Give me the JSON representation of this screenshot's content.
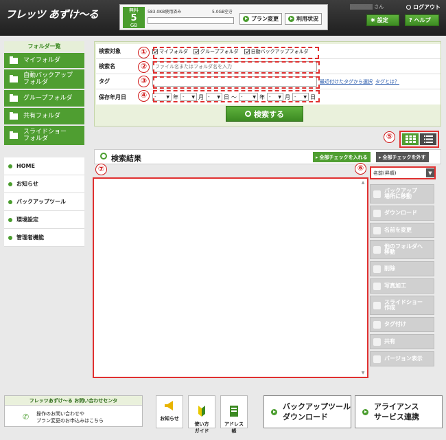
{
  "header": {
    "logo": "フレッツ あずけ〜る",
    "plan_label": "無料",
    "plan_size": "5",
    "plan_unit": "GB",
    "used": "583.0KB使用済み",
    "free": "5.0GB空き",
    "plan_change": "プラン変更",
    "usage_status": "利用状況",
    "user_suffix": "さん",
    "logout": "ログアウト",
    "settings": "設定",
    "help": "ヘルプ"
  },
  "sidebar": {
    "folder_title": "フォルダ一覧",
    "folders": [
      "マイフォルダ",
      "自動バックアップ\nフォルダ",
      "グループフォルダ",
      "共有フォルダ",
      "スライドショー\nフォルダ"
    ],
    "menu": [
      "HOME",
      "お知らせ",
      "バックアップツール",
      "環境設定",
      "管理者機能"
    ]
  },
  "search": {
    "target_label": "検索対象",
    "options": [
      "マイフォルダ",
      "グループフォルダ",
      "自動バックアップフォルダ"
    ],
    "name_label": "検索名",
    "name_placeholder": "ファイル名またはフォルダ名を入力",
    "tag_label": "タグ",
    "tag_link_recent": "最近付けたタグから選択",
    "tag_link_what": "タグとは？",
    "date_label": "保存年月日",
    "date_blank": "-",
    "year": "年",
    "month": "月",
    "day": "日",
    "tilde": "〜",
    "button": "検索する"
  },
  "annotations": [
    "①",
    "②",
    "③",
    "④",
    "⑤",
    "⑥",
    "⑦"
  ],
  "results": {
    "title": "検索結果",
    "check_all": "全部チェックを入れる",
    "uncheck_all": "全部チェックを外す",
    "sort": "名前(昇順)"
  },
  "actions": [
    "バックアップ\n場所に移動",
    "ダウンロード",
    "名前を変更",
    "他のフォルダへ\n移動",
    "削除",
    "写真加工",
    "スライドショー\n作成",
    "タグ付け",
    "共有",
    "バージョン表示"
  ],
  "footer": {
    "contact_title": "フレッツあずけ〜る お問い合わせセンタ",
    "contact_text": "操作のお問い合わせや\nプラン変更のお申込みはこちら",
    "guides": [
      "お知らせ",
      "使い方\nガイド",
      "アドレス\n帳"
    ],
    "backup_dl": "バックアップツール\nダウンロード",
    "alliance": "アライアンス\nサービス連携"
  }
}
